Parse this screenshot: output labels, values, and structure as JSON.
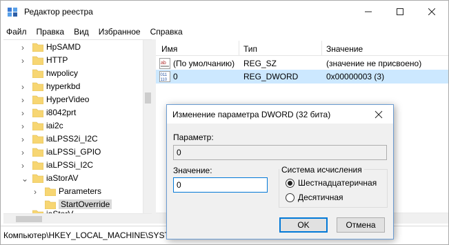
{
  "window": {
    "title": "Редактор реестра"
  },
  "menu": [
    "Файл",
    "Правка",
    "Вид",
    "Избранное",
    "Справка"
  ],
  "tree": {
    "items": [
      {
        "label": "HpSAMD",
        "expander": "›"
      },
      {
        "label": "HTTP",
        "expander": "›"
      },
      {
        "label": "hwpolicy",
        "expander": ""
      },
      {
        "label": "hyperkbd",
        "expander": "›"
      },
      {
        "label": "HyperVideo",
        "expander": "›"
      },
      {
        "label": "i8042prt",
        "expander": "›"
      },
      {
        "label": "iai2c",
        "expander": "›"
      },
      {
        "label": "iaLPSS2i_I2C",
        "expander": "›"
      },
      {
        "label": "iaLPSSi_GPIO",
        "expander": "›"
      },
      {
        "label": "iaLPSSi_I2C",
        "expander": "›"
      },
      {
        "label": "iaStorAV",
        "expander": "⌄"
      },
      {
        "label": "Parameters",
        "expander": "›"
      },
      {
        "label": "StartOverride",
        "expander": ""
      },
      {
        "label": "iaStorV",
        "expander": "›"
      }
    ]
  },
  "list": {
    "headers": {
      "name": "Имя",
      "type": "Тип",
      "value": "Значение"
    },
    "rows": [
      {
        "icon": "string-value-icon",
        "name": "(По умолчанию)",
        "type": "REG_SZ",
        "value": "(значение не присвоено)"
      },
      {
        "icon": "binary-value-icon",
        "name": "0",
        "type": "REG_DWORD",
        "value": "0x00000003 (3)"
      }
    ]
  },
  "status": {
    "path": "Компьютер\\HKEY_LOCAL_MACHINE\\SYSTEM\\CurrentControlSet\\Services\\iaStorAV\\StartOverride"
  },
  "dialog": {
    "title": "Изменение параметра DWORD (32 бита)",
    "param_label": "Параметр:",
    "param_value": "0",
    "value_label": "Значение:",
    "value_value": "0",
    "base_group": "Система исчисления",
    "radio_hex": "Шестнадцатеричная",
    "radio_dec": "Десятичная",
    "selected_base": "hex",
    "ok": "OK",
    "cancel": "Отмена"
  },
  "colors": {
    "selection": "#cce8ff",
    "accent": "#0078d7",
    "folder": "#f7d673"
  }
}
